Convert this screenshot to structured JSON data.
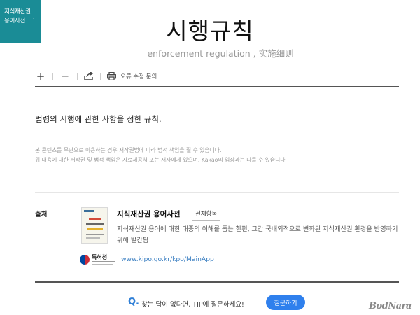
{
  "badge": {
    "line1": "지식재산권",
    "separator": ",",
    "line2": "용어사전"
  },
  "entry": {
    "title": "시행규칙",
    "subtitle": "enforcement regulation , 实施细则"
  },
  "toolbar": {
    "zoom_in_icon": "+",
    "zoom_out_icon": "—",
    "share_icon": "share-icon",
    "print_icon": "print-icon",
    "report_label": "오류 수정 문의"
  },
  "definition": "법령의 시행에 관한 사항을 정한 규칙.",
  "notice": {
    "line1": "본 콘텐츠를 무단으로 이용하는 경우 저작권법에 따라 법적 책임을 질 수 있습니다.",
    "line2": "위 내용에 대한 저작권 및 법적 책임은 자료제공처 또는 저자에게 있으며, Kakao의 입장과는 다를 수 있습니다."
  },
  "source": {
    "label": "출처",
    "dictionary_title": "지식재산권 용어사전",
    "all_items_label": "전체항목",
    "description": "지식재산권 용어에 대한 대중의 이해를 돕는 한편, 그간 국내외적으로 변화된 지식재산권 환경을 반영하기 위해 발간됨",
    "publisher_logo_text": "특허청",
    "link_text": "www.kipo.go.kr/kpo/MainApp"
  },
  "footer": {
    "q_mark": "Q.",
    "question": "찾는 답이 없다면, TIP에 질문하세요!",
    "ask_button": "질문하기"
  },
  "watermark": "BodNara",
  "colors": {
    "badge_bg": "#1a8c96",
    "link": "#3b7fc2",
    "ask_button_bg": "#2f80ed"
  }
}
